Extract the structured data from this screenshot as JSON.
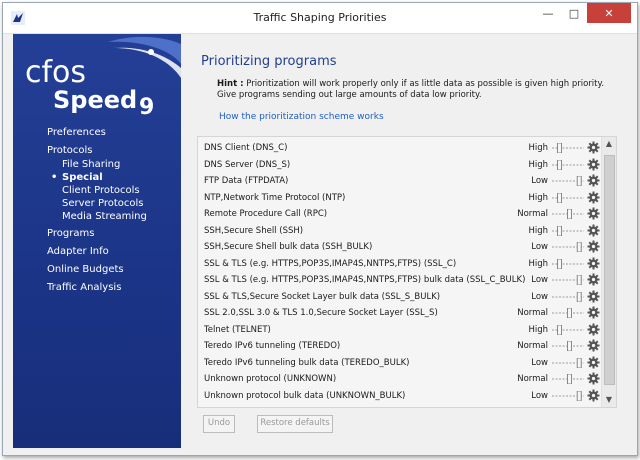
{
  "window": {
    "title": "Traffic Shaping Priorities"
  },
  "title_buttons": {
    "minimize": "—",
    "maximize": "□",
    "close": "✕"
  },
  "sidebar": {
    "logo_top": "cfos",
    "logo_bottom": "Speed",
    "logo_version": "9",
    "items": [
      {
        "label": "Preferences",
        "sub": false
      },
      {
        "label": "Protocols",
        "sub": false
      },
      {
        "label": "File Sharing",
        "sub": true
      },
      {
        "label": "Special",
        "sub": true,
        "active": true
      },
      {
        "label": "Client Protocols",
        "sub": true
      },
      {
        "label": "Server Protocols",
        "sub": true
      },
      {
        "label": "Media Streaming",
        "sub": true
      },
      {
        "label": "Programs",
        "sub": false
      },
      {
        "label": "Adapter Info",
        "sub": false
      },
      {
        "label": "Online Budgets",
        "sub": false
      },
      {
        "label": "Traffic Analysis",
        "sub": false
      }
    ]
  },
  "main": {
    "title": "Prioritizing programs",
    "hint_label": "Hint :",
    "hint_text": " Prioritization will work properly only if as little data as possible is given high priority. Give programs sending out large amounts of data low priority.",
    "scheme_link": "How the prioritization scheme works"
  },
  "rows": [
    {
      "name": "DNS Client (DNS_C)",
      "priority": "High"
    },
    {
      "name": "DNS Server (DNS_S)",
      "priority": "High"
    },
    {
      "name": "FTP Data (FTPDATA)",
      "priority": "Low"
    },
    {
      "name": "NTP,Network Time Protocol (NTP)",
      "priority": "High"
    },
    {
      "name": "Remote Procedure Call (RPC)",
      "priority": "Normal"
    },
    {
      "name": "SSH,Secure Shell (SSH)",
      "priority": "High"
    },
    {
      "name": "SSH,Secure Shell bulk data (SSH_BULK)",
      "priority": "Low"
    },
    {
      "name": "SSL & TLS (e.g. HTTPS,POP3S,IMAP4S,NNTPS,FTPS) (SSL_C)",
      "priority": "High"
    },
    {
      "name": "SSL & TLS (e.g. HTTPS,POP3S,IMAP4S,NNTPS,FTPS) bulk data (SSL_C_BULK)",
      "priority": "Low"
    },
    {
      "name": "SSL & TLS,Secure Socket Layer bulk data (SSL_S_BULK)",
      "priority": "Low"
    },
    {
      "name": "SSL 2.0,SSL 3.0 & TLS 1.0,Secure Socket Layer (SSL_S)",
      "priority": "Normal"
    },
    {
      "name": "Telnet (TELNET)",
      "priority": "High"
    },
    {
      "name": "Teredo IPv6 tunneling (TEREDO)",
      "priority": "Normal"
    },
    {
      "name": "Teredo IPv6 tunneling bulk data (TEREDO_BULK)",
      "priority": "Low"
    },
    {
      "name": "Unknown protocol (UNKNOWN)",
      "priority": "Normal"
    },
    {
      "name": "Unknown protocol bulk data (UNKNOWN_BULK)",
      "priority": "Low"
    }
  ],
  "scrollbar": {
    "up": "▲",
    "down": "▼"
  },
  "footer": {
    "undo": "Undo",
    "restore": "Restore defaults"
  },
  "colors": {
    "sidebar": "#1b3486",
    "accent": "#1f3f8f",
    "link": "#1f5fbf",
    "close": "#c7413a"
  }
}
